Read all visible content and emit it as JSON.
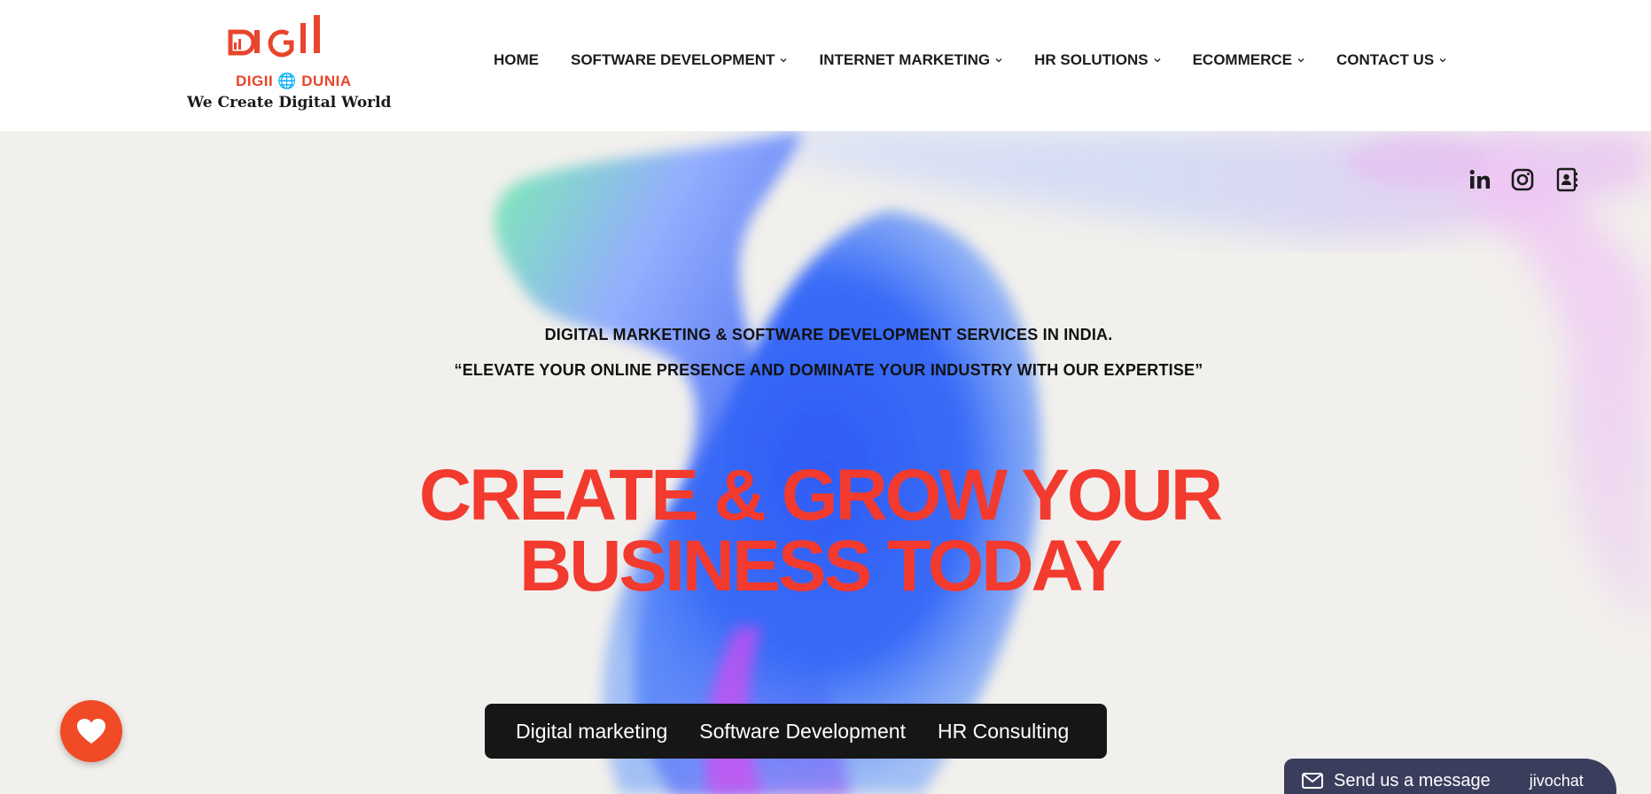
{
  "brand": {
    "logo_word": "DIGII 🌐 DUNIA",
    "tagline": "We Create Digital World",
    "accent_color": "#e8452c"
  },
  "nav": {
    "items": [
      {
        "label": "HOME",
        "has_dropdown": false
      },
      {
        "label": "SOFTWARE DEVELOPMENT",
        "has_dropdown": true
      },
      {
        "label": "INTERNET MARKETING",
        "has_dropdown": true
      },
      {
        "label": "HR SOLUTIONS",
        "has_dropdown": true
      },
      {
        "label": "ECOMMERCE",
        "has_dropdown": true
      },
      {
        "label": "CONTACT US",
        "has_dropdown": true
      }
    ]
  },
  "social": {
    "icons": [
      "linkedin-icon",
      "instagram-icon",
      "contact-book-icon"
    ]
  },
  "hero": {
    "subhead_line1": "DIGITAL MARKETING & SOFTWARE DEVELOPMENT SERVICES IN INDIA.",
    "subhead_line2": "“ELEVATE YOUR ONLINE PRESENCE AND DOMINATE YOUR INDUSTRY WITH OUR EXPERTISE”",
    "headline_line1": "CREATE & GROW YOUR",
    "headline_line2": "BUSINESS TODAY",
    "headline_color": "#f23a2f",
    "services": [
      {
        "label": "Digital marketing"
      },
      {
        "label": "Software Development"
      },
      {
        "label": "HR Consulting"
      }
    ]
  },
  "chat": {
    "label": "Send us a message",
    "brand": "jivochat"
  },
  "favorite_button": {
    "icon": "heart-icon",
    "color": "#f04a27"
  }
}
